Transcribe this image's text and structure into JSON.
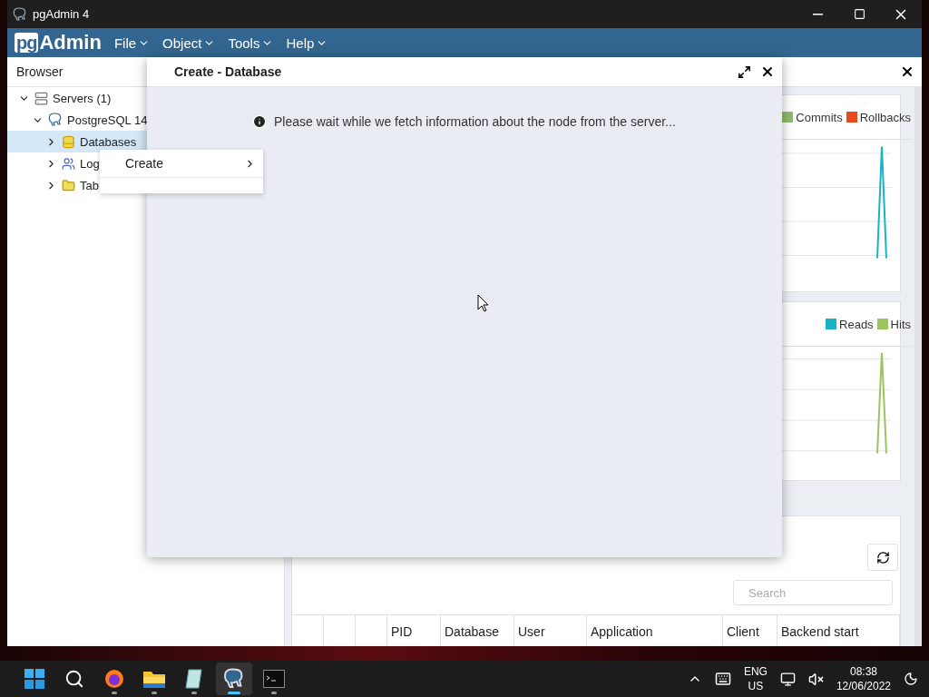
{
  "window": {
    "title": "pgAdmin 4"
  },
  "menu_bar": {
    "logo_box": "pg",
    "logo_text": "Admin",
    "menus": [
      "File",
      "Object",
      "Tools",
      "Help"
    ]
  },
  "browser": {
    "title": "Browser",
    "tree": [
      {
        "label": "Servers (1)",
        "kind": "servers",
        "expanded": true,
        "selected": false,
        "children": [
          {
            "label": "PostgreSQL 14",
            "kind": "server",
            "expanded": true,
            "selected": false,
            "children": [
              {
                "label": "Databases",
                "kind": "databases",
                "expanded": false,
                "selected": true
              },
              {
                "label": "Log",
                "kind": "roles",
                "expanded": false,
                "selected": false
              },
              {
                "label": "Tab",
                "kind": "tablespaces",
                "expanded": false,
                "selected": false
              }
            ]
          }
        ]
      }
    ]
  },
  "context_menu": {
    "items": [
      {
        "label": "Create",
        "has_submenu": true
      }
    ]
  },
  "dialog": {
    "title": "Create - Database",
    "message": "Please wait while we fetch information about the node from the server..."
  },
  "dashboard": {
    "cards": [
      {
        "legend": [
          {
            "label": "Commits",
            "color": "#8fbc6a"
          },
          {
            "label": "Rollbacks",
            "color": "#e8491d"
          }
        ]
      },
      {
        "legend": [
          {
            "label": "Reads",
            "color": "#1ab3c4"
          },
          {
            "label": "Hits",
            "color": "#9bc45e"
          }
        ]
      }
    ],
    "activity": {
      "search": {
        "placeholder": "Search"
      },
      "columns": [
        "PID",
        "Database",
        "User",
        "Application",
        "Client",
        "Backend start"
      ]
    }
  },
  "taskbar": {
    "apps": [
      {
        "kind": "start",
        "selected": false,
        "running": false
      },
      {
        "kind": "search",
        "selected": false,
        "running": false
      },
      {
        "kind": "browser",
        "selected": false,
        "running": true
      },
      {
        "kind": "files",
        "selected": false,
        "running": true
      },
      {
        "kind": "notepad",
        "selected": false,
        "running": true
      },
      {
        "kind": "pgadmin",
        "selected": true,
        "running": true
      },
      {
        "kind": "terminal",
        "selected": false,
        "running": true
      }
    ],
    "language": "ENG",
    "region": "US",
    "time": "08:38",
    "date": "12/06/2022"
  }
}
